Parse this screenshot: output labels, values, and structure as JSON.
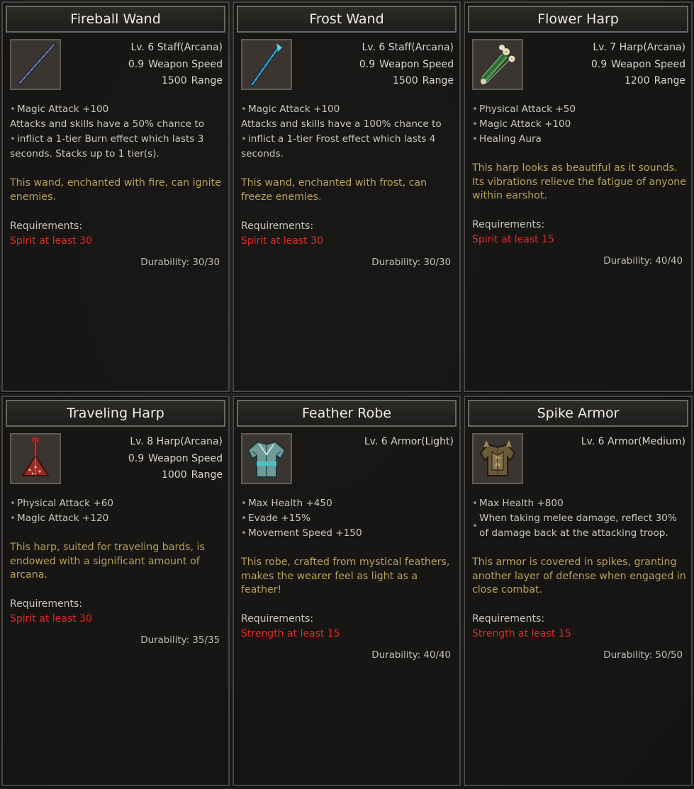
{
  "colors": {
    "description": "#b8a05a",
    "requirement": "#e02a24",
    "title_text": "#f1ede6",
    "frame": "#4a4846"
  },
  "items": [
    {
      "name": "Fireball Wand",
      "icon": "wand-icon",
      "level_type": "Lv. 6 Staff(Arcana)",
      "weapon_speed": "0.9",
      "weapon_speed_label": "Weapon Speed",
      "range": "1500",
      "range_label": "Range",
      "effects": [
        "Magic Attack +100",
        "Attacks and skills have a 50% chance to",
        "inflict a 1-tier Burn effect which lasts 3",
        "seconds. Stacks up to 1 tier(s)."
      ],
      "description": "This wand, enchanted with fire, can ignite enemies.",
      "requirements_label": "Requirements:",
      "requirement": "Spirit at least 30",
      "durability": "Durability: 30/30"
    },
    {
      "name": "Frost Wand",
      "icon": "frost-wand-icon",
      "level_type": "Lv. 6 Staff(Arcana)",
      "weapon_speed": "0.9",
      "weapon_speed_label": "Weapon Speed",
      "range": "1500",
      "range_label": "Range",
      "effects": [
        "Magic Attack +100",
        "Attacks and skills have a 100% chance to",
        "inflict a 1-tier Frost effect which lasts 4",
        "seconds."
      ],
      "description": "This wand, enchanted with frost, can freeze enemies.",
      "requirements_label": "Requirements:",
      "requirement": "Spirit at least 30",
      "durability": "Durability: 30/30"
    },
    {
      "name": "Flower Harp",
      "icon": "flower-harp-icon",
      "level_type": "Lv. 7 Harp(Arcana)",
      "weapon_speed": "0.9",
      "weapon_speed_label": "Weapon Speed",
      "range": "1200",
      "range_label": "Range",
      "effects": [
        "Physical Attack +50",
        "Magic Attack +100",
        "Healing Aura"
      ],
      "description": "This harp looks as beautiful as it sounds. Its vibrations relieve the fatigue of anyone within earshot.",
      "requirements_label": "Requirements:",
      "requirement": "Spirit at least 15",
      "durability": "Durability: 40/40"
    },
    {
      "name": "Traveling Harp",
      "icon": "traveling-harp-icon",
      "level_type": "Lv. 8 Harp(Arcana)",
      "weapon_speed": "0.9",
      "weapon_speed_label": "Weapon Speed",
      "range": "1000",
      "range_label": "Range",
      "effects": [
        "Physical Attack +60",
        "Magic Attack +120"
      ],
      "description": "This harp, suited for traveling bards, is endowed with a significant amount of arcana.",
      "requirements_label": "Requirements:",
      "requirement": "Spirit at least 30",
      "durability": "Durability: 35/35"
    },
    {
      "name": "Feather Robe",
      "icon": "robe-icon",
      "level_type": "Lv. 6 Armor(Light)",
      "effects": [
        "Max Health +450",
        "Evade +15%",
        "Movement Speed +150"
      ],
      "description": "This robe, crafted from mystical feathers, makes the wearer feel as light as a feather!",
      "requirements_label": "Requirements:",
      "requirement": "Strength at least 15",
      "durability": "Durability: 40/40"
    },
    {
      "name": "Spike Armor",
      "icon": "spike-armor-icon",
      "level_type": "Lv. 6 Armor(Medium)",
      "effects": [
        "Max Health +800",
        "When taking melee damage, reflect 30%",
        "of damage back at the attacking troop."
      ],
      "description": "This armor is covered in spikes, granting another layer of defense when engaged in close combat.",
      "requirements_label": "Requirements:",
      "requirement": "Strength at least 15",
      "durability": "Durability: 50/50"
    }
  ]
}
